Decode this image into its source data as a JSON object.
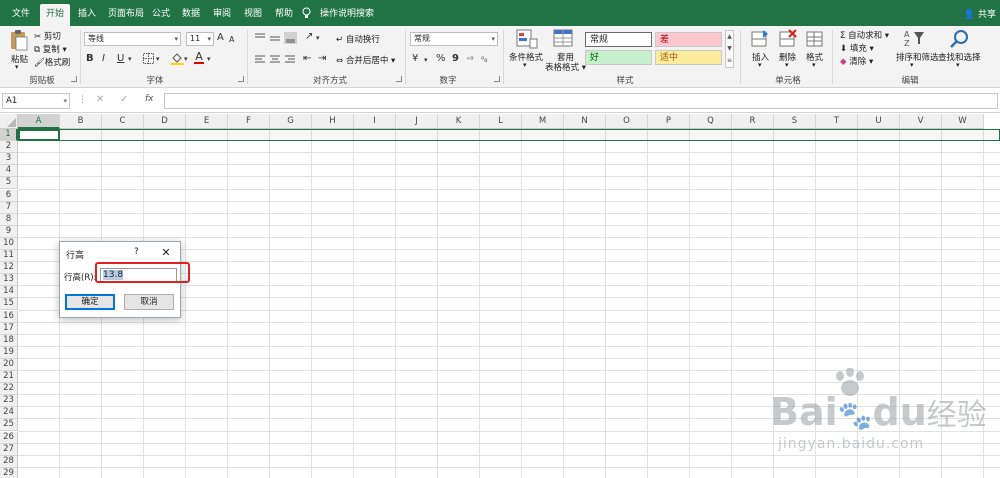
{
  "tabs": [
    {
      "label": "文件"
    },
    {
      "label": "开始"
    },
    {
      "label": "插入"
    },
    {
      "label": "页面布局"
    },
    {
      "label": "公式"
    },
    {
      "label": "数据"
    },
    {
      "label": "审阅"
    },
    {
      "label": "视图"
    },
    {
      "label": "帮助"
    }
  ],
  "tell_me": "操作说明搜索",
  "share": "共享",
  "clipboard": {
    "paste": "粘贴",
    "cut": "剪切",
    "copy": "复制",
    "format_painter": "格式刷",
    "group": "剪贴板"
  },
  "font": {
    "name": "等线",
    "size": "11",
    "bold": "B",
    "italic": "I",
    "underline": "U",
    "font_color_glyph": "A",
    "grow": "A",
    "shrink": "A",
    "group": "字体"
  },
  "alignment": {
    "wrap": "自动换行",
    "merge": "合并后居中",
    "group": "对齐方式"
  },
  "number": {
    "format": "常规",
    "percent": "%",
    "comma": "9",
    "group": "数字"
  },
  "styles": {
    "conditional": "条件格式",
    "table1": "套用",
    "table2": "表格格式",
    "normal": "常规",
    "bad": "差",
    "good": "好",
    "neutral": "适中",
    "group": "样式",
    "colors": {
      "bad_bg": "#ffc7ce",
      "bad_fg": "#9c0006",
      "good_bg": "#c6efce",
      "good_fg": "#006100",
      "neutral_bg": "#ffeb9c",
      "neutral_fg": "#9c5700"
    }
  },
  "cells": {
    "insert": "插入",
    "delete": "删除",
    "format": "格式",
    "group": "单元格"
  },
  "editing": {
    "autosum": "自动求和",
    "fill": "填充",
    "clear": "清除",
    "sort": "排序和筛选",
    "find": "查找和选择",
    "group": "编辑"
  },
  "formula_bar": {
    "name_box": "A1",
    "fx": "fx",
    "cancel": "✕",
    "enter": "✓",
    "value": ""
  },
  "columns": [
    "A",
    "B",
    "C",
    "D",
    "E",
    "F",
    "G",
    "H",
    "I",
    "J",
    "K",
    "L",
    "M",
    "N",
    "O",
    "P",
    "Q",
    "R",
    "S",
    "T",
    "U",
    "V",
    "W"
  ],
  "rows": [
    "1",
    "2",
    "3",
    "4",
    "5",
    "6",
    "7",
    "8",
    "9",
    "10",
    "11",
    "12",
    "13",
    "14",
    "15",
    "16",
    "17",
    "18",
    "19",
    "20",
    "21",
    "22",
    "23",
    "24",
    "25",
    "26",
    "27",
    "28",
    "29",
    "30"
  ],
  "dialog": {
    "title": "行高",
    "help": "?",
    "close": "✕",
    "label": "行高(R):",
    "value": "13.8",
    "ok": "确定",
    "cancel": "取消"
  },
  "watermark": {
    "brand": "Bai",
    "brand2": "du",
    "cn": "经验",
    "url": "jingyan.baidu.com"
  },
  "accent": "#217346"
}
